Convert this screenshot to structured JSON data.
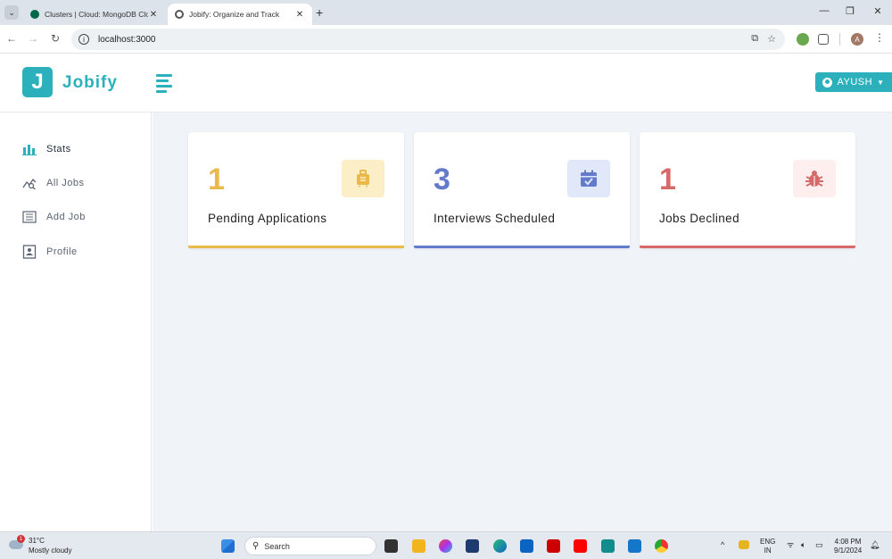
{
  "browser": {
    "tabs": [
      {
        "title": "Clusters | Cloud: MongoDB Clo",
        "active": false,
        "favicon_color": "#00684a"
      },
      {
        "title": "Jobify: Organize and Track",
        "active": true,
        "favicon_color": "#555555"
      }
    ],
    "url": "localhost:3000",
    "profile_initial": "A"
  },
  "app": {
    "logo_letter": "J",
    "logo_text": "Jobify",
    "user_name": "AYUSH",
    "accent_color": "#2cb1bc"
  },
  "sidebar": {
    "items": [
      {
        "label": "Stats",
        "icon": "stats-icon",
        "active": true
      },
      {
        "label": "All Jobs",
        "icon": "all-jobs-icon",
        "active": false
      },
      {
        "label": "Add Job",
        "icon": "add-job-icon",
        "active": false
      },
      {
        "label": "Profile",
        "icon": "profile-icon",
        "active": false
      }
    ]
  },
  "stats": [
    {
      "count": "1",
      "label": "Pending Applications",
      "icon": "suitcase-icon",
      "color": "#e9b949",
      "bg": "#fcefc7"
    },
    {
      "count": "3",
      "label": "Interviews Scheduled",
      "icon": "calendar-check-icon",
      "color": "#647acb",
      "bg": "#e0e8f9"
    },
    {
      "count": "1",
      "label": "Jobs Declined",
      "icon": "bug-icon",
      "color": "#d66a6a",
      "bg": "#ffeeee"
    }
  ],
  "taskbar": {
    "weather_temp": "31°C",
    "weather_cond": "Mostly cloudy",
    "weather_badge": "1",
    "search_placeholder": "Search",
    "lang_top": "ENG",
    "lang_bottom": "IN",
    "time": "4:08 PM",
    "date": "9/1/2024"
  }
}
